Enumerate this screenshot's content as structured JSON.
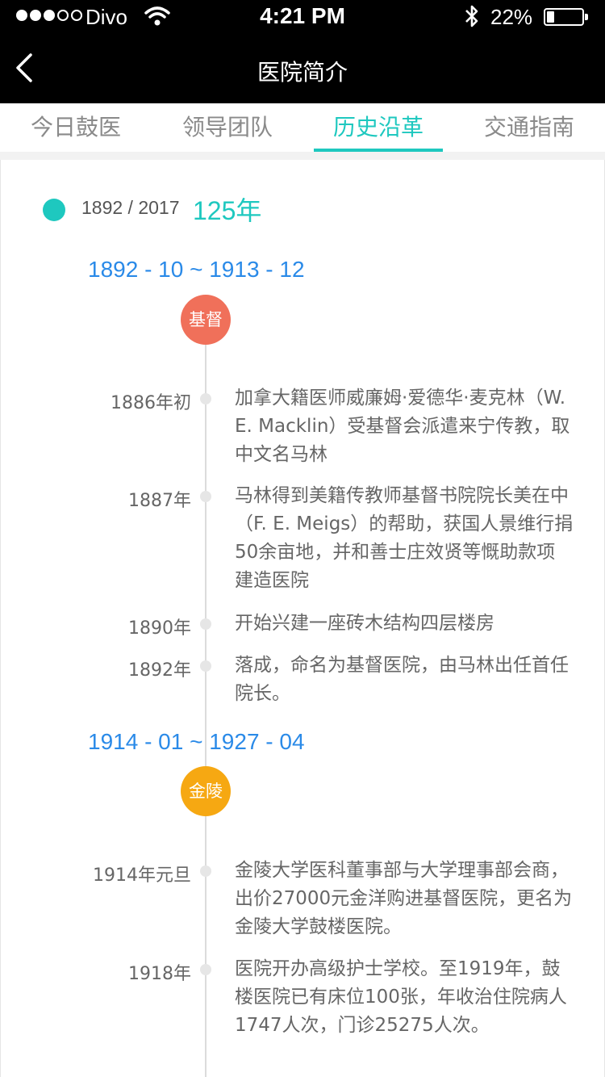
{
  "status": {
    "carrier": "Divo",
    "time": "4:21 PM",
    "battery": "22%",
    "battery_level": 0.22
  },
  "nav": {
    "title": "医院简介",
    "back_icon": "chevron-left-icon"
  },
  "tabs": [
    {
      "label": "今日鼓医",
      "active": false
    },
    {
      "label": "领导团队",
      "active": false
    },
    {
      "label": "历史沿革",
      "active": true
    },
    {
      "label": "交通指南",
      "active": false
    }
  ],
  "timeline": {
    "years": "1892 / 2017",
    "span": "125年",
    "eras": [
      {
        "range": "1892 - 10 ~ 1913 - 12",
        "badge": "基督",
        "badge_color": "#f0705a",
        "events": [
          {
            "date": "1886年初",
            "text": "加拿大籍医师威廉姆·爱德华·麦克林（W. E. Macklin）受基督会派遣来宁传教，取中文名马林"
          },
          {
            "date": "1887年",
            "text": "马林得到美籍传教师基督书院院长美在中（F. E. Meigs）的帮助，获国人景维行捐50余亩地，并和善士庄效贤等慨助款项建造医院"
          },
          {
            "date": "1890年",
            "text": "开始兴建一座砖木结构四层楼房"
          },
          {
            "date": "1892年",
            "text": "落成，命名为基督医院，由马林出任首任院长。"
          }
        ]
      },
      {
        "range": "1914 - 01 ~ 1927 - 04",
        "badge": "金陵",
        "badge_color": "#f6a812",
        "events": [
          {
            "date": "1914年元旦",
            "text": "金陵大学医科董事部与大学理事部会商，出价27000元金洋购进基督医院，更名为金陵大学鼓楼医院。"
          },
          {
            "date": "1918年",
            "text": "医院开办高级护士学校。至1919年，鼓楼医院已有床位100张，年收治住院病人1747人次，门诊25275人次。"
          }
        ]
      }
    ]
  }
}
